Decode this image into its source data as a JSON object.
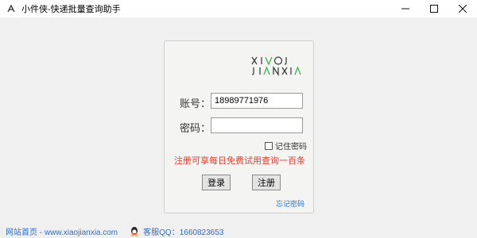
{
  "window": {
    "title": "小件侠-快递批量查询助手",
    "controls": {
      "minimize": "—",
      "maximize": "☐",
      "close": "✕"
    }
  },
  "login": {
    "logo_line1": "XIVOJ",
    "logo_line2": "JIANXIA",
    "account_label": "账号：",
    "account_value": "18989771976",
    "password_label": "密码：",
    "password_value": "",
    "remember_label": "记住密码",
    "remember_checked": false,
    "promo_text": "注册可享每日免费试用查询一百条",
    "login_button": "登录",
    "register_button": "注册",
    "forgot_link": "忘记密码"
  },
  "status": {
    "website": "网站首页 - www.xiaojianxia.com",
    "support_qq": "客服QQ：1660823653"
  },
  "colors": {
    "promo": "#e8402f",
    "link": "#2a6fd6",
    "logo_accent": "#2fb34a"
  }
}
